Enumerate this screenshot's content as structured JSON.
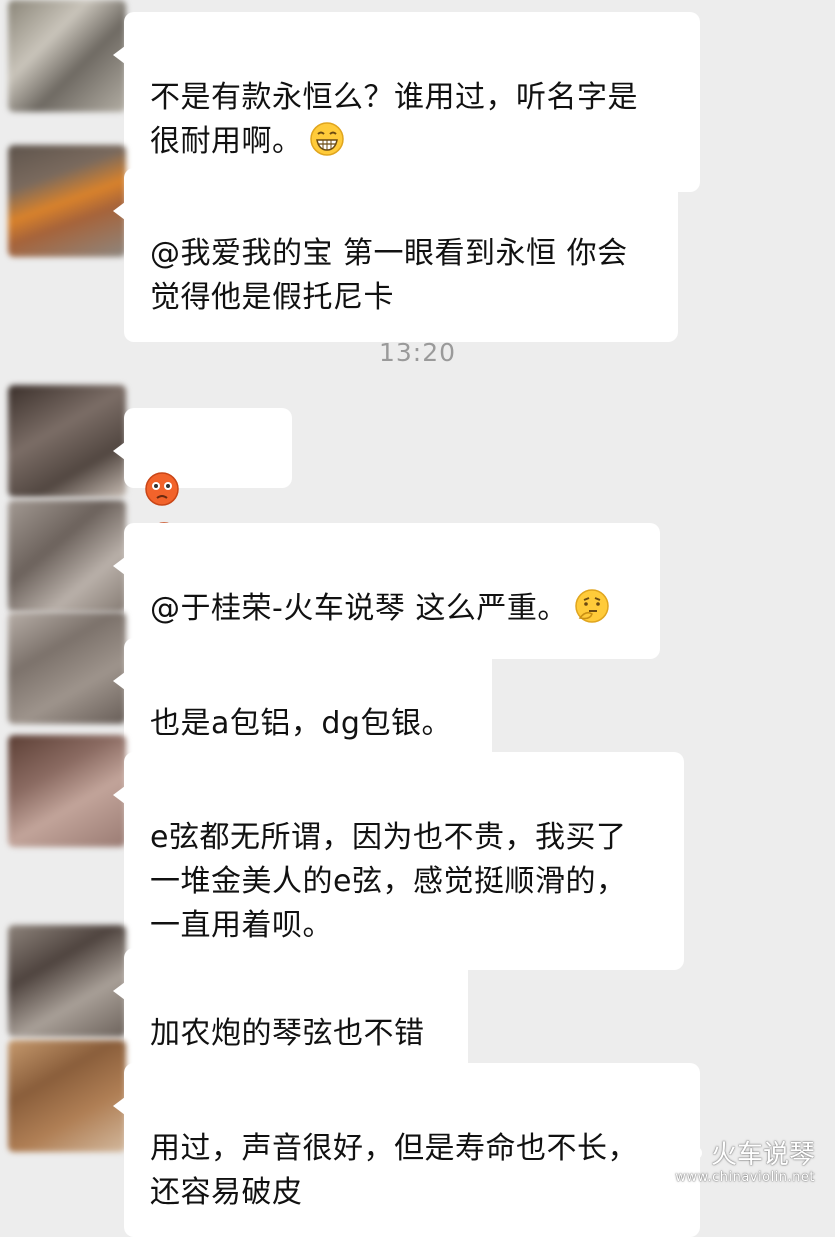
{
  "timestamp": "13:20",
  "messages": [
    {
      "text": "不是有款永恒么？谁用过，听名字是\n很耐用啊。",
      "emoji": "grinning-face-icon"
    },
    {
      "text": "@我爱我的宝 第一眼看到永恒 你会\n觉得他是假托尼卡",
      "emoji": null
    },
    {
      "text": "",
      "emoji": "flushed-face-icon x3"
    },
    {
      "text": "@于桂荣-火车说琴 这么严重。",
      "emoji": "thinking-face-icon"
    },
    {
      "text": "也是a包铝，dg包银。",
      "emoji": null
    },
    {
      "text": "e弦都无所谓，因为也不贵，我买了\n一堆金美人的e弦，感觉挺顺滑的，\n一直用着呗。",
      "emoji": null
    },
    {
      "text": "加农炮的琴弦也不错",
      "emoji": null
    },
    {
      "text": "用过，声音很好，但是寿命也不长，\n还容易破皮",
      "emoji": null
    }
  ],
  "watermark": {
    "title": "火车说琴",
    "url": "www.chinaviolin.net",
    "icon": "wechat-icon"
  },
  "colors": {
    "background": "#ededed",
    "bubble": "#ffffff",
    "text": "#111111",
    "timestamp": "#9a9a9a"
  }
}
